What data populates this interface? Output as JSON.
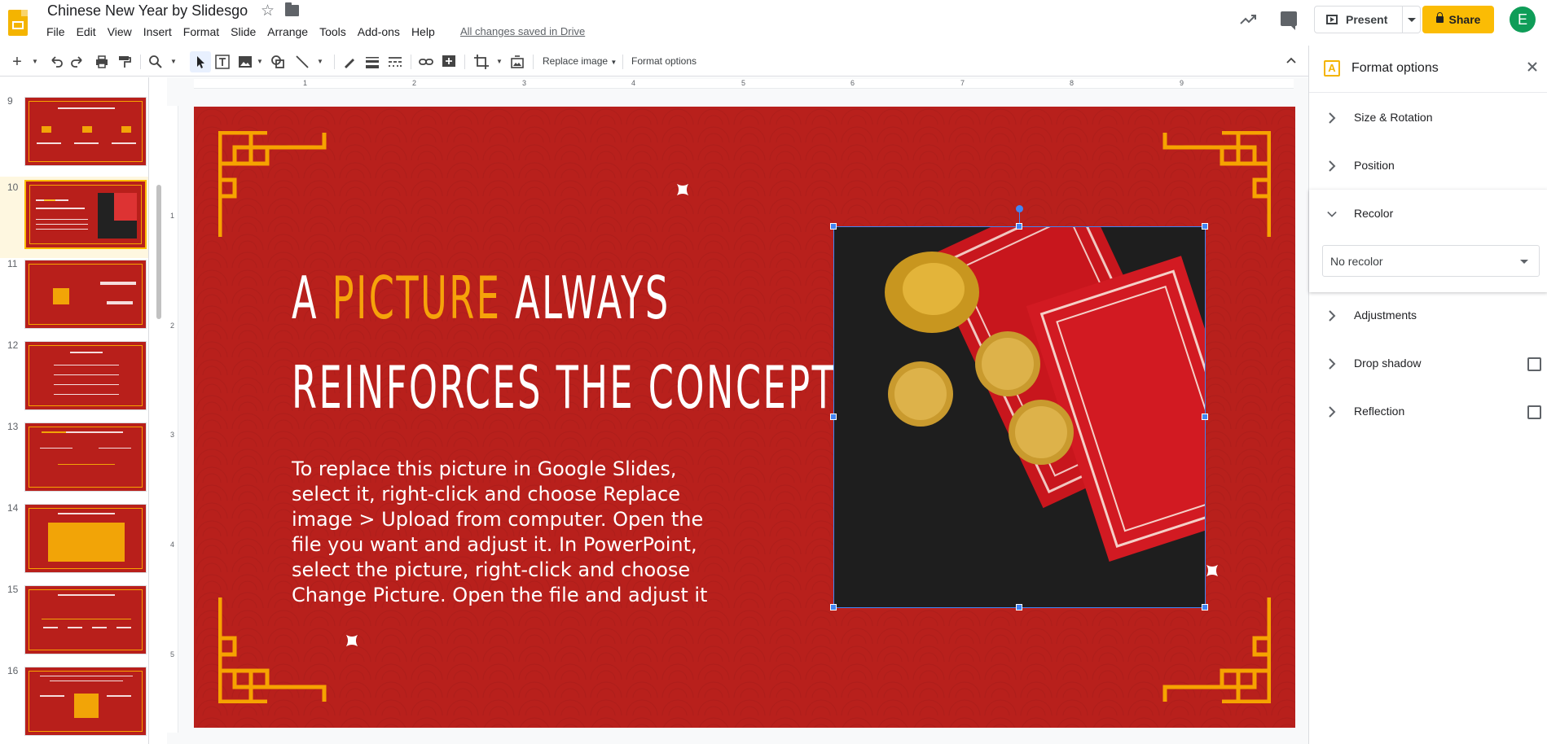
{
  "header": {
    "title": "Chinese New Year by Slidesgo",
    "menu": [
      "File",
      "Edit",
      "View",
      "Insert",
      "Format",
      "Slide",
      "Arrange",
      "Tools",
      "Add-ons",
      "Help"
    ],
    "saved_status": "All changes saved in Drive",
    "present_label": "Present",
    "share_label": "Share",
    "avatar_initial": "E"
  },
  "toolbar": {
    "replace_image_label": "Replace image",
    "format_options_label": "Format options"
  },
  "filmstrip": {
    "slides": [
      {
        "number": "9",
        "selected": false
      },
      {
        "number": "10",
        "selected": true
      },
      {
        "number": "11",
        "selected": false
      },
      {
        "number": "12",
        "selected": false
      },
      {
        "number": "13",
        "selected": false
      },
      {
        "number": "14",
        "selected": false
      },
      {
        "number": "15",
        "selected": false
      },
      {
        "number": "16",
        "selected": false
      }
    ]
  },
  "ruler": {
    "horizontal": [
      "1",
      "2",
      "3",
      "4",
      "5",
      "6",
      "7",
      "8",
      "9"
    ],
    "vertical": [
      "1",
      "2",
      "3",
      "4",
      "5"
    ]
  },
  "slide": {
    "heading_line1_a": "A ",
    "heading_highlight": "PICTURE",
    "heading_line1_b": " ALWAYS",
    "heading_line2": "REINFORCES THE CONCEPT",
    "body": "To replace this picture in Google Slides, select it, right-click and choose Replace image > Upload from computer. Open the file you want and adjust it. In PowerPoint, select the picture, right-click and choose Change Picture. Open the file and adjust it",
    "colors": {
      "background": "#b8201c",
      "accent": "#f6a30a",
      "text": "#ffffff"
    }
  },
  "panel": {
    "title": "Format options",
    "sections": {
      "size_rotation": "Size & Rotation",
      "position": "Position",
      "recolor": "Recolor",
      "adjustments": "Adjustments",
      "drop_shadow": "Drop shadow",
      "reflection": "Reflection"
    },
    "recolor_value": "No recolor"
  }
}
